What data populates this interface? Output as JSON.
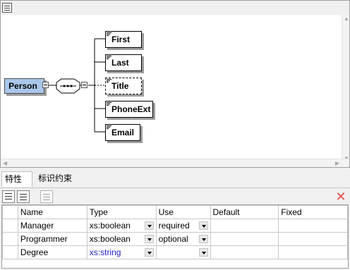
{
  "diagram": {
    "root": "Person",
    "children": [
      {
        "label": "First",
        "optional": false
      },
      {
        "label": "Last",
        "optional": false
      },
      {
        "label": "Title",
        "optional": true
      },
      {
        "label": "PhoneExt",
        "optional": false
      },
      {
        "label": "Email",
        "optional": false
      }
    ],
    "compositor": "sequence"
  },
  "tabs": [
    {
      "label": "特性"
    },
    {
      "label": "标识约束"
    }
  ],
  "toolbar": {
    "icons": [
      "insert-row-icon",
      "append-row-icon",
      "list-icon",
      "delete-icon"
    ]
  },
  "grid": {
    "columns": [
      "Name",
      "Type",
      "Use",
      "Default",
      "Fixed"
    ],
    "rows": [
      {
        "name": "Manager",
        "type": "xs:boolean",
        "use": "required",
        "default": "",
        "fixed": ""
      },
      {
        "name": "Programmer",
        "type": "xs:boolean",
        "use": "optional",
        "default": "",
        "fixed": ""
      },
      {
        "name": "Degree",
        "type": "xs:string",
        "use": "",
        "default": "",
        "fixed": ""
      }
    ]
  },
  "colors": {
    "root_fill": "#a9c7ea",
    "delete_icon": "#e54b4b",
    "string_type": "#1f1fc8"
  }
}
